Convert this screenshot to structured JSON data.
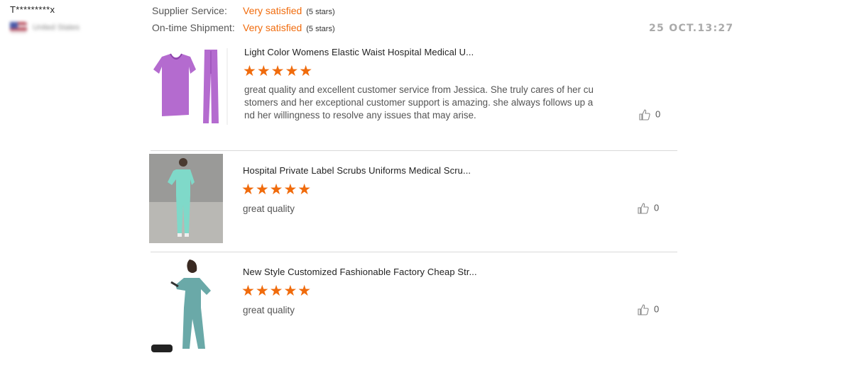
{
  "reviewer": {
    "name": "T*********x",
    "country": "United States"
  },
  "ratings": [
    {
      "label": "Supplier Service:",
      "value": "Very satisfied",
      "stars": "(5 stars)"
    },
    {
      "label": "On-time Shipment:",
      "value": "Very satisfied",
      "stars": "(5 stars)"
    }
  ],
  "timestamp": "25 OCT.13:27",
  "accent_color": "#f06b0c",
  "reviews": [
    {
      "title": "Light Color Womens Elastic Waist Hospital Medical U...",
      "rating": 5,
      "stars": "★★★★★",
      "text": "great quality and excellent customer service from Jessica. She truly cares of her customers and her exceptional customer support is amazing. she always follows up and her willingness to resolve any issues that may arise.",
      "likes": "0",
      "image_icon": "scrubs-set-purple"
    },
    {
      "title": "Hospital Private Label Scrubs Uniforms Medical Scru...",
      "rating": 5,
      "stars": "★★★★★",
      "text": "great quality",
      "likes": "0",
      "image_icon": "scrubs-model-mint"
    },
    {
      "title": "New Style Customized Fashionable Factory Cheap Str...",
      "rating": 5,
      "stars": "★★★★★",
      "text": "great quality",
      "likes": "0",
      "image_icon": "scrubs-model-teal"
    }
  ]
}
